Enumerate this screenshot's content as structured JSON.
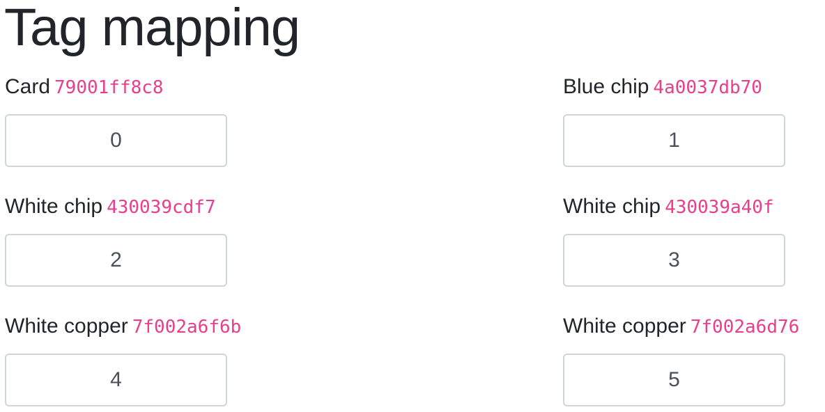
{
  "page": {
    "title": "Tag mapping"
  },
  "colors": {
    "text": "#212529",
    "tag_id": "#e83e8c",
    "input_border": "#ced4da",
    "input_text": "#495057"
  },
  "tags": [
    {
      "label": "Card",
      "id": "79001ff8c8",
      "value": "0"
    },
    {
      "label": "Blue chip",
      "id": "4a0037db70",
      "value": "1"
    },
    {
      "label": "White chip",
      "id": "430039cdf7",
      "value": "2"
    },
    {
      "label": "White chip",
      "id": "430039a40f",
      "value": "3"
    },
    {
      "label": "White copper",
      "id": "7f002a6f6b",
      "value": "4"
    },
    {
      "label": "White copper",
      "id": "7f002a6d76",
      "value": "5"
    }
  ]
}
